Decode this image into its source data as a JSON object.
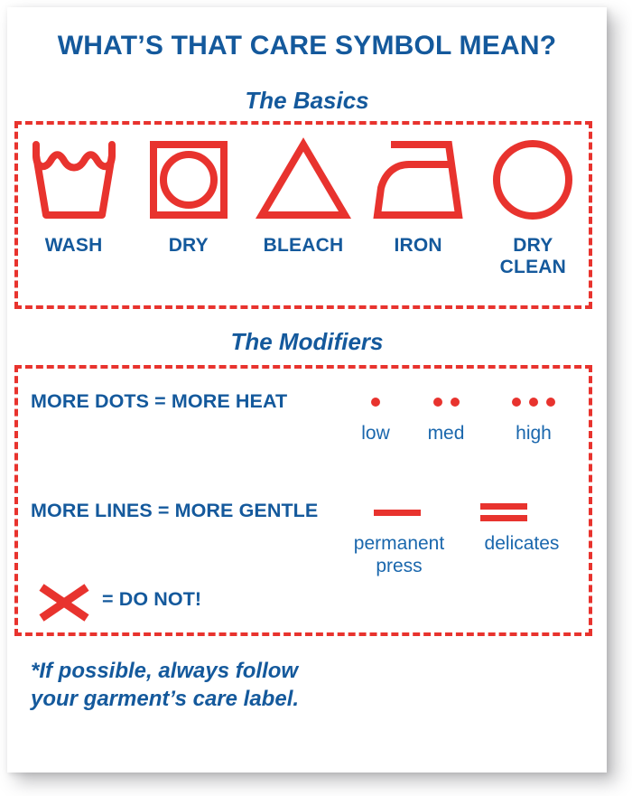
{
  "colors": {
    "blue": "#14599c",
    "red": "#e8332e",
    "card": "#ffffff"
  },
  "header": {
    "title": "WHAT’S THAT CARE SYMBOL MEAN?"
  },
  "basics": {
    "heading": "The Basics",
    "symbols": [
      {
        "icon": "wash-tub-icon",
        "label": "WASH"
      },
      {
        "icon": "dry-square-circle-icon",
        "label": "DRY"
      },
      {
        "icon": "bleach-triangle-icon",
        "label": "BLEACH"
      },
      {
        "icon": "iron-icon",
        "label": "IRON"
      },
      {
        "icon": "dry-clean-circle-icon",
        "label": "DRY\nCLEAN"
      }
    ]
  },
  "modifiers": {
    "heading": "The Modifiers",
    "dots_rule": "MORE DOTS = MORE HEAT",
    "dot_levels": [
      {
        "count": 1,
        "label": "low"
      },
      {
        "count": 2,
        "label": "med"
      },
      {
        "count": 3,
        "label": "high"
      }
    ],
    "lines_rule": "MORE LINES = MORE GENTLE",
    "line_levels": [
      {
        "count": 1,
        "label": "permanent press"
      },
      {
        "count": 2,
        "label": "delicates"
      }
    ],
    "do_not_rule": "= DO NOT!",
    "do_not_icon": "x-cross-icon"
  },
  "footer": {
    "line1": "*If possible, always follow",
    "line2": "your garment’s care label."
  }
}
